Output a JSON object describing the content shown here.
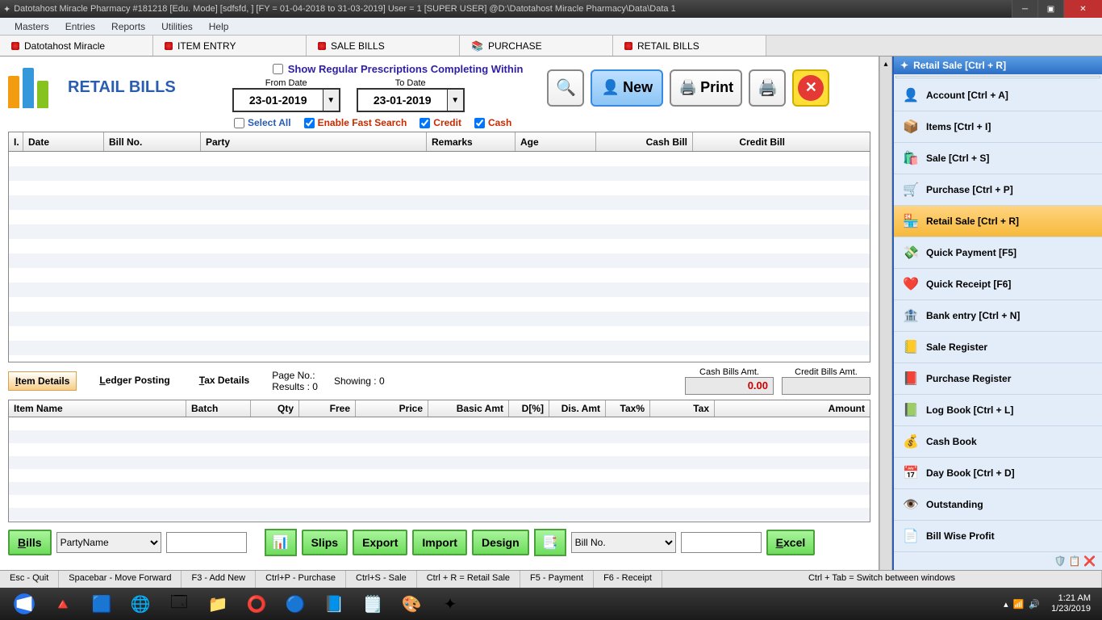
{
  "window": {
    "title": "Datotahost Miracle Pharmacy #181218  [Edu. Mode]  [sdfsfd, ] [FY = 01-04-2018 to 31-03-2019] User = 1 [SUPER USER]  @D:\\Datotahost Miracle Pharmacy\\Data\\Data 1"
  },
  "menu": [
    "Masters",
    "Entries",
    "Reports",
    "Utilities",
    "Help"
  ],
  "tabs": [
    {
      "label": "Datotahost Miracle"
    },
    {
      "label": "ITEM ENTRY"
    },
    {
      "label": "SALE BILLS"
    },
    {
      "label": "PURCHASE"
    },
    {
      "label": "RETAIL BILLS",
      "active": true
    }
  ],
  "page": {
    "title": "RETAIL BILLS",
    "prescription_label": "Show Regular Prescriptions Completing Within",
    "from_label": "From Date",
    "to_label": "To Date",
    "from_date": "23-01-2019",
    "to_date": "23-01-2019",
    "select_all": "Select All",
    "enable_fast": "Enable Fast Search",
    "credit": "Credit",
    "cash": "Cash"
  },
  "buttons": {
    "new": "New",
    "print": "Print"
  },
  "grid1": {
    "cols": [
      "I.",
      "Date",
      "Bill No.",
      "Party",
      "Remarks",
      "Age",
      "Cash Bill",
      "Credit Bill"
    ]
  },
  "midtabs": {
    "item_details": "Item Details",
    "ledger_posting": "Ledger Posting",
    "tax_details": "Tax Details",
    "page_no": "Page No.:",
    "results": "Results : 0",
    "showing": "Showing :   0",
    "cash_bills_amt_label": "Cash Bills Amt.",
    "cash_bills_amt": "0.00",
    "credit_bills_amt_label": "Credit Bills Amt."
  },
  "grid2": {
    "cols": [
      "Item Name",
      "Batch",
      "Qty",
      "Free",
      "Price",
      "Basic Amt",
      "D[%]",
      "Dis. Amt",
      "Tax%",
      "Tax",
      "Amount"
    ]
  },
  "bottom": {
    "bills": "Bills",
    "party_name": "PartyName",
    "slips": "Slips",
    "export": "Export",
    "import": "Import",
    "design": "Design",
    "bill_no": "Bill No.",
    "excel": "Excel"
  },
  "status": [
    "Esc - Quit",
    "Spacebar - Move Forward",
    "F3 - Add New",
    "Ctrl+P - Purchase",
    "Ctrl+S - Sale",
    "Ctrl + R = Retail Sale",
    "F5 - Payment",
    "F6 - Receipt",
    "Ctrl + Tab = Switch between windows"
  ],
  "rsb": {
    "title": "Retail Sale [Ctrl + R]",
    "items": [
      {
        "icon": "👤",
        "label": "Account [Ctrl + A]"
      },
      {
        "icon": "📦",
        "label": "Items [Ctrl + I]"
      },
      {
        "icon": "🛍️",
        "label": "Sale [Ctrl + S]"
      },
      {
        "icon": "🛒",
        "label": "Purchase [Ctrl + P]"
      },
      {
        "icon": "🏪",
        "label": "Retail Sale [Ctrl + R]",
        "sel": true
      },
      {
        "icon": "💸",
        "label": "Quick Payment [F5]"
      },
      {
        "icon": "❤️",
        "label": "Quick Receipt [F6]"
      },
      {
        "icon": "🏦",
        "label": "Bank entry [Ctrl + N]"
      },
      {
        "icon": "📒",
        "label": "Sale Register"
      },
      {
        "icon": "📕",
        "label": "Purchase Register"
      },
      {
        "icon": "📗",
        "label": "Log Book [Ctrl + L]"
      },
      {
        "icon": "💰",
        "label": "Cash Book"
      },
      {
        "icon": "📅",
        "label": "Day Book [Ctrl + D]"
      },
      {
        "icon": "👁️",
        "label": "Outstanding"
      },
      {
        "icon": "📄",
        "label": "Bill Wise Profit"
      }
    ]
  },
  "tray": {
    "time": "1:21 AM",
    "date": "1/23/2019"
  }
}
